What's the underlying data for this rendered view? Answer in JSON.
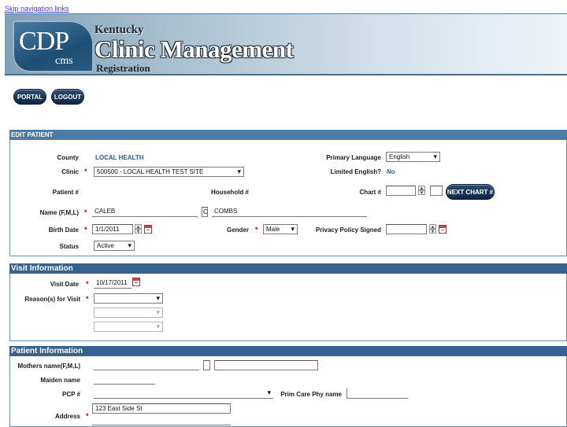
{
  "skip_link": "Skip navigation links",
  "banner": {
    "logo_main": "CDP",
    "logo_sub": "cms",
    "state": "Kentucky",
    "title": "Clinic Management",
    "subtitle": "Registration"
  },
  "nav": {
    "portal": "PORTAL",
    "logout": "LOGOUT"
  },
  "edit_patient": {
    "header": "EDIT PATIENT",
    "county_label": "County",
    "county_value": "LOCAL HEALTH",
    "clinic_label": "Clinic",
    "clinic_value": "500500 - LOCAL HEALTH TEST SITE",
    "patient_num_label": "Patient #",
    "household_label": "Household #",
    "name_label": "Name (F,M,L)",
    "first_name": "CALEB",
    "middle_initial": "C",
    "last_name": "COMBS",
    "birth_date_label": "Birth Date",
    "birth_date": "1/1/2011",
    "status_label": "Status",
    "status_value": "Active",
    "primary_language_label": "Primary Language",
    "primary_language_value": "English",
    "limited_english_label": "Limited English?",
    "limited_english_value": "No",
    "chart_label": "Chart #",
    "next_chart_button": "NEXT CHART #",
    "gender_label": "Gender",
    "gender_value": "Male",
    "privacy_label": "Privacy Policy Signed"
  },
  "visit": {
    "header": "Visit Information",
    "visit_date_label": "Visit Date",
    "visit_date": "10/17/2011",
    "reason_label": "Reason(s) for Visit"
  },
  "patient_info": {
    "header": "Patient Information",
    "mothers_name_label": "Mothers name(F,M,L)",
    "maiden_name_label": "Maiden name",
    "pcp_label": "PCP #",
    "prim_care_label": "Prim Care Phy name",
    "address_label": "Address",
    "address_value": "123 East Side St"
  }
}
